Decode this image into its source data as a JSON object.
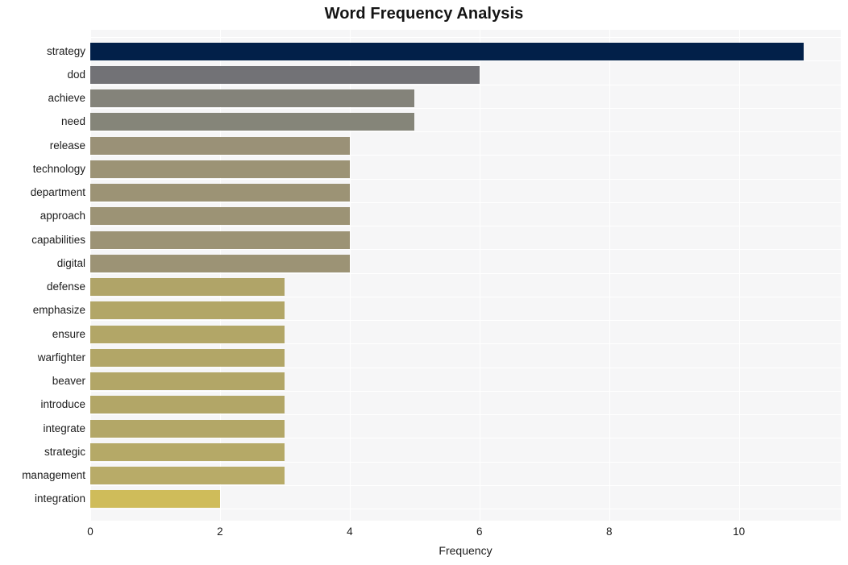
{
  "chart_data": {
    "type": "bar",
    "orientation": "horizontal",
    "title": "Word Frequency Analysis",
    "xlabel": "Frequency",
    "ylabel": "",
    "xlim": [
      0,
      11.57
    ],
    "xticks": [
      0,
      2,
      4,
      6,
      8,
      10
    ],
    "xtick_labels": [
      "0",
      "2",
      "4",
      "6",
      "8",
      "10"
    ],
    "grid": true,
    "grid_color": "#ffffff",
    "plot_background": "#f6f6f7",
    "figure_background": "#ffffff",
    "legend": null,
    "categories": [
      "strategy",
      "dod",
      "achieve",
      "need",
      "release",
      "technology",
      "department",
      "approach",
      "capabilities",
      "digital",
      "defense",
      "emphasize",
      "ensure",
      "warfighter",
      "beaver",
      "introduce",
      "integrate",
      "strategic",
      "management",
      "integration"
    ],
    "values": [
      11,
      6,
      5,
      5,
      4,
      4,
      4,
      4,
      4,
      4,
      3,
      3,
      3,
      3,
      3,
      3,
      3,
      3,
      3,
      2
    ],
    "bar_colors": [
      "#022049",
      "#727276",
      "#84837a",
      "#858579",
      "#9a9177",
      "#9c9375",
      "#9c9375",
      "#9c9375",
      "#9c9375",
      "#9c9375",
      "#b0a468",
      "#b2a667",
      "#b2a667",
      "#b2a667",
      "#b2a667",
      "#b2a667",
      "#b3a767",
      "#b5a967",
      "#b8ab68",
      "#cfbc5a"
    ]
  }
}
